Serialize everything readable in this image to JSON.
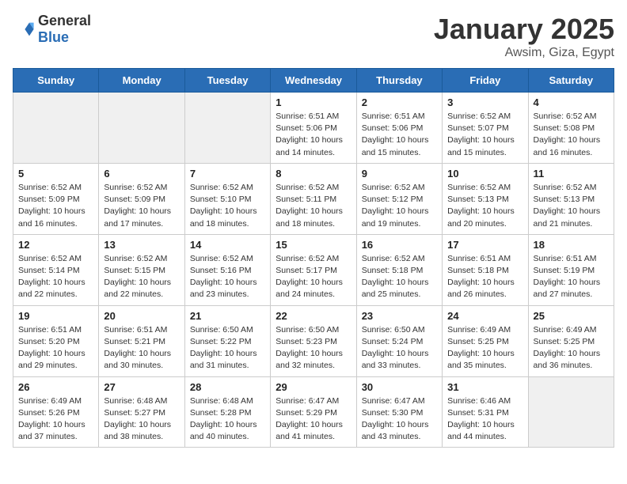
{
  "header": {
    "logo_general": "General",
    "logo_blue": "Blue",
    "month_title": "January 2025",
    "location": "Awsim, Giza, Egypt"
  },
  "weekdays": [
    "Sunday",
    "Monday",
    "Tuesday",
    "Wednesday",
    "Thursday",
    "Friday",
    "Saturday"
  ],
  "weeks": [
    [
      {
        "day": "",
        "info": ""
      },
      {
        "day": "",
        "info": ""
      },
      {
        "day": "",
        "info": ""
      },
      {
        "day": "1",
        "info": "Sunrise: 6:51 AM\nSunset: 5:06 PM\nDaylight: 10 hours\nand 14 minutes."
      },
      {
        "day": "2",
        "info": "Sunrise: 6:51 AM\nSunset: 5:06 PM\nDaylight: 10 hours\nand 15 minutes."
      },
      {
        "day": "3",
        "info": "Sunrise: 6:52 AM\nSunset: 5:07 PM\nDaylight: 10 hours\nand 15 minutes."
      },
      {
        "day": "4",
        "info": "Sunrise: 6:52 AM\nSunset: 5:08 PM\nDaylight: 10 hours\nand 16 minutes."
      }
    ],
    [
      {
        "day": "5",
        "info": "Sunrise: 6:52 AM\nSunset: 5:09 PM\nDaylight: 10 hours\nand 16 minutes."
      },
      {
        "day": "6",
        "info": "Sunrise: 6:52 AM\nSunset: 5:09 PM\nDaylight: 10 hours\nand 17 minutes."
      },
      {
        "day": "7",
        "info": "Sunrise: 6:52 AM\nSunset: 5:10 PM\nDaylight: 10 hours\nand 18 minutes."
      },
      {
        "day": "8",
        "info": "Sunrise: 6:52 AM\nSunset: 5:11 PM\nDaylight: 10 hours\nand 18 minutes."
      },
      {
        "day": "9",
        "info": "Sunrise: 6:52 AM\nSunset: 5:12 PM\nDaylight: 10 hours\nand 19 minutes."
      },
      {
        "day": "10",
        "info": "Sunrise: 6:52 AM\nSunset: 5:13 PM\nDaylight: 10 hours\nand 20 minutes."
      },
      {
        "day": "11",
        "info": "Sunrise: 6:52 AM\nSunset: 5:13 PM\nDaylight: 10 hours\nand 21 minutes."
      }
    ],
    [
      {
        "day": "12",
        "info": "Sunrise: 6:52 AM\nSunset: 5:14 PM\nDaylight: 10 hours\nand 22 minutes."
      },
      {
        "day": "13",
        "info": "Sunrise: 6:52 AM\nSunset: 5:15 PM\nDaylight: 10 hours\nand 22 minutes."
      },
      {
        "day": "14",
        "info": "Sunrise: 6:52 AM\nSunset: 5:16 PM\nDaylight: 10 hours\nand 23 minutes."
      },
      {
        "day": "15",
        "info": "Sunrise: 6:52 AM\nSunset: 5:17 PM\nDaylight: 10 hours\nand 24 minutes."
      },
      {
        "day": "16",
        "info": "Sunrise: 6:52 AM\nSunset: 5:18 PM\nDaylight: 10 hours\nand 25 minutes."
      },
      {
        "day": "17",
        "info": "Sunrise: 6:51 AM\nSunset: 5:18 PM\nDaylight: 10 hours\nand 26 minutes."
      },
      {
        "day": "18",
        "info": "Sunrise: 6:51 AM\nSunset: 5:19 PM\nDaylight: 10 hours\nand 27 minutes."
      }
    ],
    [
      {
        "day": "19",
        "info": "Sunrise: 6:51 AM\nSunset: 5:20 PM\nDaylight: 10 hours\nand 29 minutes."
      },
      {
        "day": "20",
        "info": "Sunrise: 6:51 AM\nSunset: 5:21 PM\nDaylight: 10 hours\nand 30 minutes."
      },
      {
        "day": "21",
        "info": "Sunrise: 6:50 AM\nSunset: 5:22 PM\nDaylight: 10 hours\nand 31 minutes."
      },
      {
        "day": "22",
        "info": "Sunrise: 6:50 AM\nSunset: 5:23 PM\nDaylight: 10 hours\nand 32 minutes."
      },
      {
        "day": "23",
        "info": "Sunrise: 6:50 AM\nSunset: 5:24 PM\nDaylight: 10 hours\nand 33 minutes."
      },
      {
        "day": "24",
        "info": "Sunrise: 6:49 AM\nSunset: 5:25 PM\nDaylight: 10 hours\nand 35 minutes."
      },
      {
        "day": "25",
        "info": "Sunrise: 6:49 AM\nSunset: 5:25 PM\nDaylight: 10 hours\nand 36 minutes."
      }
    ],
    [
      {
        "day": "26",
        "info": "Sunrise: 6:49 AM\nSunset: 5:26 PM\nDaylight: 10 hours\nand 37 minutes."
      },
      {
        "day": "27",
        "info": "Sunrise: 6:48 AM\nSunset: 5:27 PM\nDaylight: 10 hours\nand 38 minutes."
      },
      {
        "day": "28",
        "info": "Sunrise: 6:48 AM\nSunset: 5:28 PM\nDaylight: 10 hours\nand 40 minutes."
      },
      {
        "day": "29",
        "info": "Sunrise: 6:47 AM\nSunset: 5:29 PM\nDaylight: 10 hours\nand 41 minutes."
      },
      {
        "day": "30",
        "info": "Sunrise: 6:47 AM\nSunset: 5:30 PM\nDaylight: 10 hours\nand 43 minutes."
      },
      {
        "day": "31",
        "info": "Sunrise: 6:46 AM\nSunset: 5:31 PM\nDaylight: 10 hours\nand 44 minutes."
      },
      {
        "day": "",
        "info": ""
      }
    ]
  ]
}
